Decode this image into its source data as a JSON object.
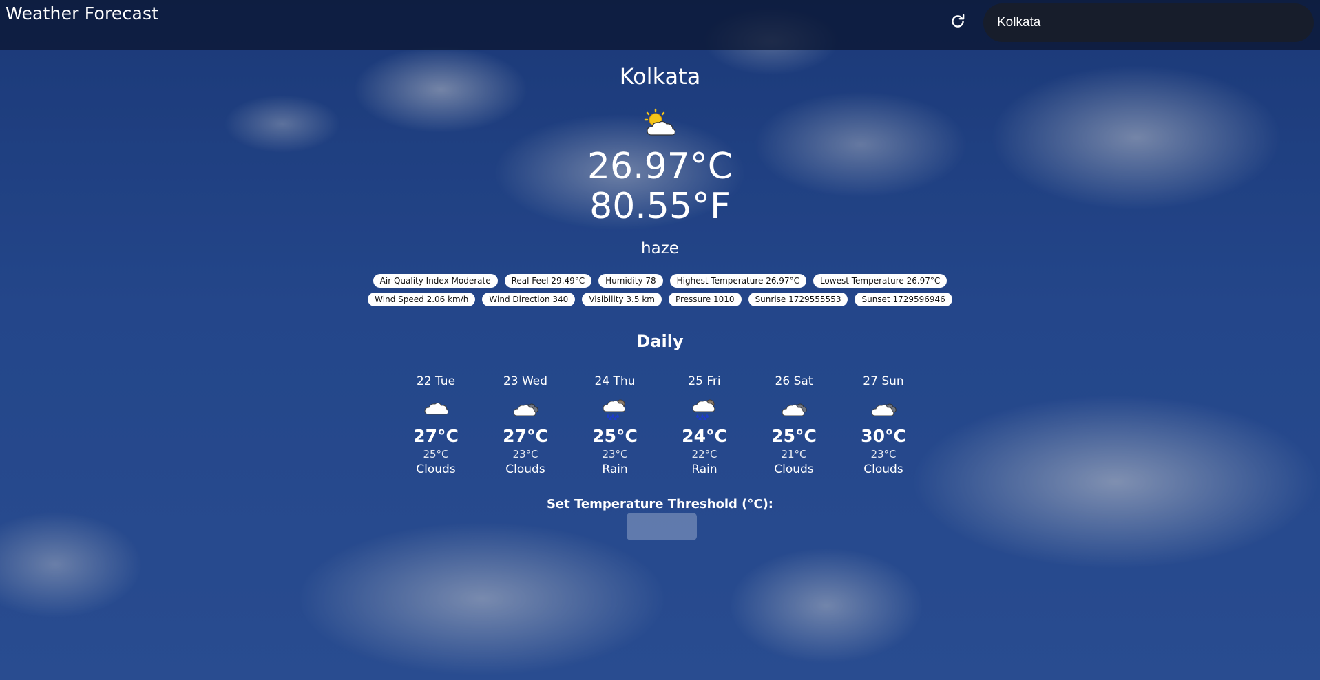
{
  "header": {
    "title": "Weather Forecast",
    "refresh_icon": "refresh-icon"
  },
  "search": {
    "value": "Kolkata"
  },
  "current": {
    "city": "Kolkata",
    "icon": "partly-cloudy-sun-icon",
    "temp_c": "26.97°C",
    "temp_f": "80.55°F",
    "description": "haze"
  },
  "details_row1": [
    "Air Quality Index Moderate",
    "Real Feel 29.49°C",
    "Humidity 78",
    "Highest Temperature 26.97°C",
    "Lowest Temperature 26.97°C"
  ],
  "details_row2": [
    "Wind Speed 2.06 km/h",
    "Wind Direction 340",
    "Visibility 3.5 km",
    "Pressure 1010",
    "Sunrise 1729555553",
    "Sunset 1729596946"
  ],
  "daily": {
    "title": "Daily",
    "days": [
      {
        "label": "22 Tue",
        "icon": "cloud-icon",
        "high": "27°C",
        "low": "25°C",
        "condition": "Clouds"
      },
      {
        "label": "23 Wed",
        "icon": "cloud-dark-icon",
        "high": "27°C",
        "low": "23°C",
        "condition": "Clouds"
      },
      {
        "label": "24 Thu",
        "icon": "rain-cloud-icon",
        "high": "25°C",
        "low": "23°C",
        "condition": "Rain"
      },
      {
        "label": "25 Fri",
        "icon": "rain-cloud-icon",
        "high": "24°C",
        "low": "22°C",
        "condition": "Rain"
      },
      {
        "label": "26 Sat",
        "icon": "cloud-dark-icon",
        "high": "25°C",
        "low": "21°C",
        "condition": "Clouds"
      },
      {
        "label": "27 Sun",
        "icon": "cloud-dark-icon",
        "high": "30°C",
        "low": "23°C",
        "condition": "Clouds"
      }
    ]
  },
  "threshold": {
    "label": "Set Temperature Threshold (°C):",
    "value": ""
  },
  "colors": {
    "topbar": "#0a142d",
    "chip_bg": "#ffffff",
    "sky": "#2e58a8"
  }
}
